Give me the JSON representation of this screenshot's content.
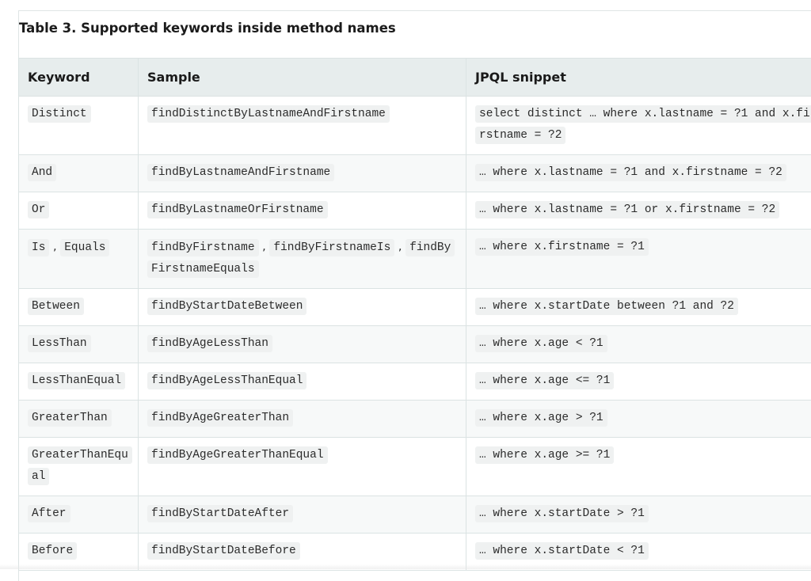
{
  "caption": "Table 3. Supported keywords inside method names",
  "headers": [
    "Keyword",
    "Sample",
    "JPQL snippet"
  ],
  "rows": [
    {
      "keywords": [
        "Distinct"
      ],
      "samples": [
        "findDistinctByLastnameAndFirstname"
      ],
      "jpql": "select distinct … where x.lastname = ?1 and x.firstname = ?2"
    },
    {
      "keywords": [
        "And"
      ],
      "samples": [
        "findByLastnameAndFirstname"
      ],
      "jpql": "… where x.lastname = ?1 and x.firstname = ?2"
    },
    {
      "keywords": [
        "Or"
      ],
      "samples": [
        "findByLastnameOrFirstname"
      ],
      "jpql": "… where x.lastname = ?1 or x.firstname = ?2"
    },
    {
      "keywords": [
        "Is",
        "Equals"
      ],
      "samples": [
        "findByFirstname",
        "findByFirstnameIs",
        "findByFirstnameEquals"
      ],
      "jpql": "… where x.firstname = ?1"
    },
    {
      "keywords": [
        "Between"
      ],
      "samples": [
        "findByStartDateBetween"
      ],
      "jpql": "… where x.startDate between ?1 and ?2"
    },
    {
      "keywords": [
        "LessThan"
      ],
      "samples": [
        "findByAgeLessThan"
      ],
      "jpql": "… where x.age < ?1"
    },
    {
      "keywords": [
        "LessThanEqual"
      ],
      "samples": [
        "findByAgeLessThanEqual"
      ],
      "jpql": "… where x.age <= ?1"
    },
    {
      "keywords": [
        "GreaterThan"
      ],
      "samples": [
        "findByAgeGreaterThan"
      ],
      "jpql": "… where x.age > ?1"
    },
    {
      "keywords": [
        "GreaterThanEqual"
      ],
      "samples": [
        "findByAgeGreaterThanEqual"
      ],
      "jpql": "… where x.age >= ?1"
    },
    {
      "keywords": [
        "After"
      ],
      "samples": [
        "findByStartDateAfter"
      ],
      "jpql": "… where x.startDate > ?1"
    },
    {
      "keywords": [
        "Before"
      ],
      "samples": [
        "findByStartDateBefore"
      ],
      "jpql": "… where x.startDate < ?1"
    }
  ]
}
